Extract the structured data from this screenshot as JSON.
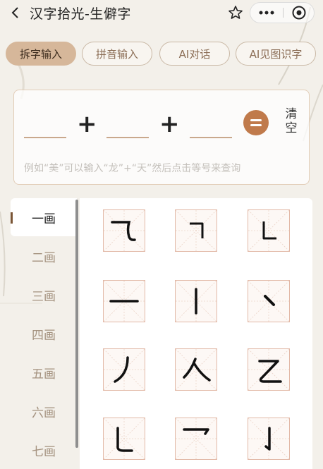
{
  "header": {
    "title": "汉字拾光-生僻字"
  },
  "tabs": [
    {
      "label": "拆字输入",
      "active": true
    },
    {
      "label": "拼音输入",
      "active": false
    },
    {
      "label": "AI对话",
      "active": false
    },
    {
      "label": "AI见图识字",
      "active": false
    }
  ],
  "input": {
    "plus_sign": "+",
    "clear_label": "清空",
    "hint": "例如“美”可以输入“龙”+“天”然后点击等号来查询"
  },
  "strokes": {
    "categories": [
      "一画",
      "二画",
      "三画",
      "四画",
      "五画",
      "六画",
      "七画"
    ],
    "active_index": 0,
    "components": [
      {
        "name": "横折弯钩-like"
      },
      {
        "name": "横折"
      },
      {
        "name": "竖折"
      },
      {
        "name": "横"
      },
      {
        "name": "竖"
      },
      {
        "name": "点"
      },
      {
        "name": "撇"
      },
      {
        "name": "捺"
      },
      {
        "name": "乙"
      },
      {
        "name": "竖弯钩"
      },
      {
        "name": "横钩"
      },
      {
        "name": "竖钩"
      }
    ]
  },
  "colors": {
    "accent": "#c07a4b",
    "tab_active": "#d6b79a",
    "cell_border": "#e2b9a7"
  }
}
